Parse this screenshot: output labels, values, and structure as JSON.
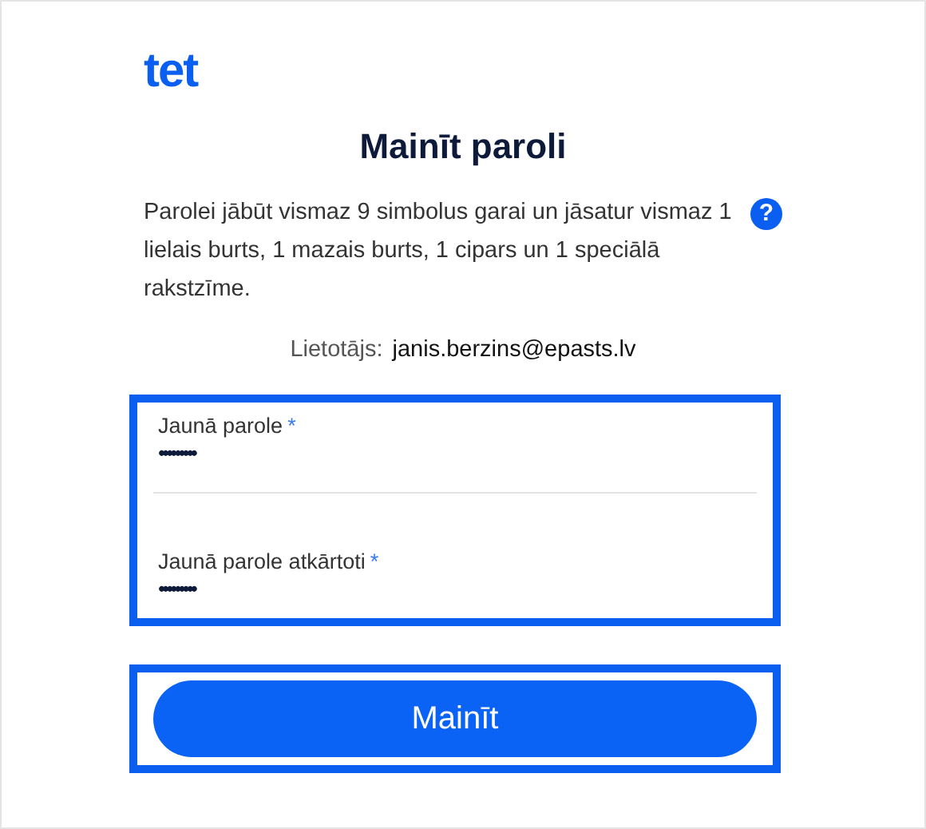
{
  "logo": "tet",
  "title": "Mainīt paroli",
  "description": "Parolei jābūt vismaz 9 simbolus garai un jāsatur vismaz 1 lielais burts, 1 mazais burts, 1 cipars un 1 speciālā rakstzīme.",
  "help": "?",
  "user": {
    "label": "Lietotājs:",
    "value": "janis.berzins@epasts.lv"
  },
  "fields": [
    {
      "label": "Jaunā parole",
      "required_mark": "*",
      "value": "•••••••••"
    },
    {
      "label": "Jaunā parole atkārtoti",
      "required_mark": "*",
      "value": "•••••••••"
    }
  ],
  "button": "Mainīt"
}
